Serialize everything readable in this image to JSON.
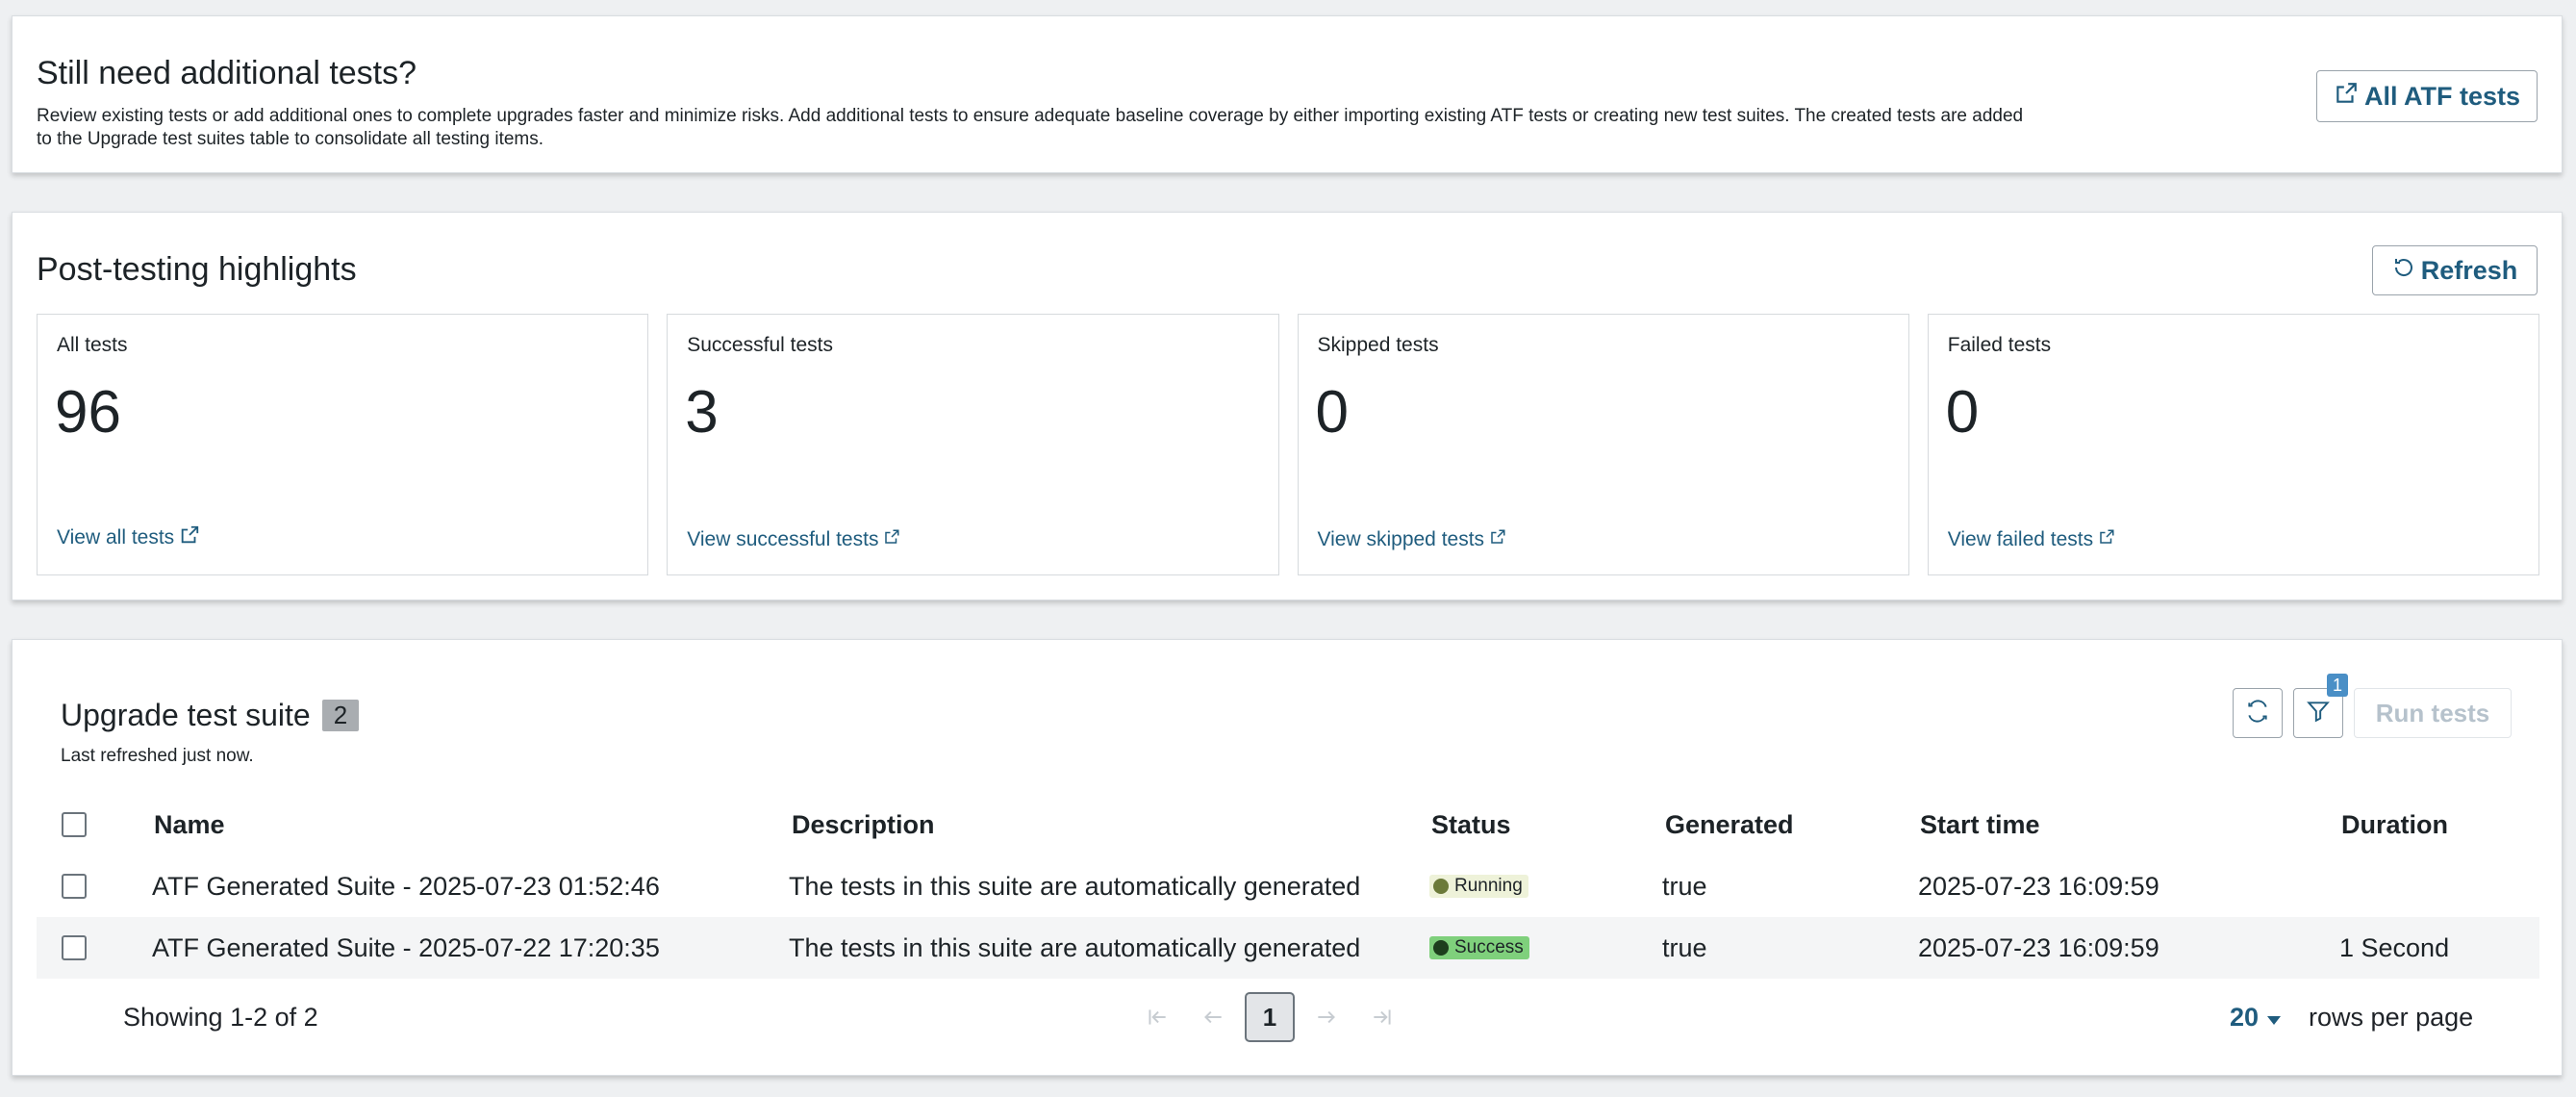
{
  "additional": {
    "title": "Still need additional tests?",
    "description": "Review existing tests or add additional ones to complete upgrades faster and minimize risks. Add additional tests to ensure adequate baseline coverage by either importing existing ATF tests or creating new test suites. The created tests are added to the Upgrade test suites table to consolidate all testing items.",
    "button_label": "All ATF tests"
  },
  "highlights": {
    "title": "Post-testing highlights",
    "refresh_label": "Refresh",
    "cards": [
      {
        "label": "All tests",
        "value": "96",
        "link": "View all tests"
      },
      {
        "label": "Successful tests",
        "value": "3",
        "link": "View successful tests"
      },
      {
        "label": "Skipped tests",
        "value": "0",
        "link": "View skipped tests"
      },
      {
        "label": "Failed tests",
        "value": "0",
        "link": "View failed tests"
      }
    ]
  },
  "suite": {
    "title": "Upgrade test suite",
    "count": "2",
    "subtitle": "Last refreshed just now.",
    "filter_count": "1",
    "run_label": "Run tests",
    "columns": {
      "name": "Name",
      "description": "Description",
      "status": "Status",
      "generated": "Generated",
      "start": "Start time",
      "duration": "Duration"
    },
    "rows": [
      {
        "name": "ATF Generated Suite  - 2025-07-23 01:52:46",
        "description": "The tests in this suite are automatically generated",
        "status": "Running",
        "generated": "true",
        "start": "2025-07-23 16:09:59",
        "duration": ""
      },
      {
        "name": "ATF Generated Suite  - 2025-07-22 17:20:35",
        "description": "The tests in this suite are automatically generated",
        "status": "Success",
        "generated": "true",
        "start": "2025-07-23 16:09:59",
        "duration": "1 Second"
      }
    ],
    "pagination": {
      "showing": "Showing 1-2 of 2",
      "current_page": "1",
      "rows_per_page_value": "20",
      "rows_per_page_label": "rows per page"
    }
  },
  "colors": {
    "link": "#1f5c7e",
    "running_bg": "#eef2d9",
    "running_dot": "#6b7a3a",
    "success_bg": "#7fd07c",
    "success_dot": "#1d3f1d"
  }
}
